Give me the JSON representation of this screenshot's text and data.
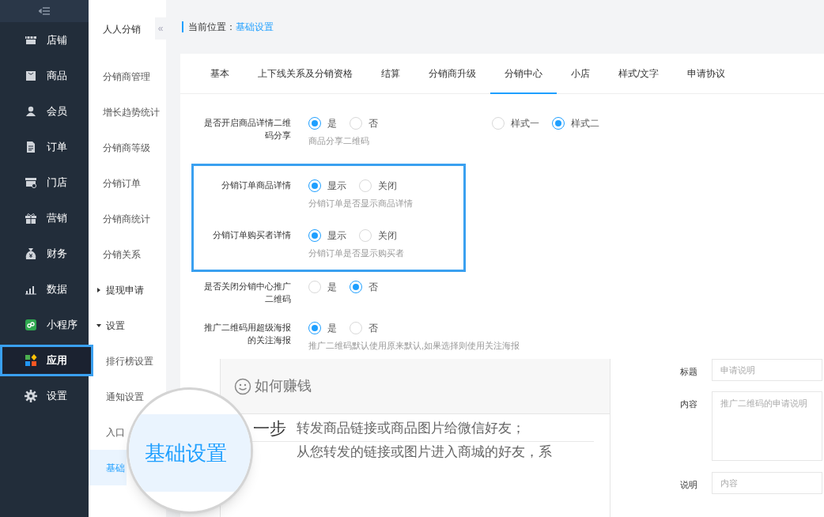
{
  "sidebar": {
    "items": [
      {
        "label": "店铺",
        "selected": false
      },
      {
        "label": "商品",
        "selected": false
      },
      {
        "label": "会员",
        "selected": false
      },
      {
        "label": "订单",
        "selected": false
      },
      {
        "label": "门店",
        "selected": false
      },
      {
        "label": "营销",
        "selected": false
      },
      {
        "label": "财务",
        "selected": false
      },
      {
        "label": "数据",
        "selected": false
      },
      {
        "label": "小程序",
        "selected": false
      },
      {
        "label": "应用",
        "selected": true
      },
      {
        "label": "设置",
        "selected": false
      }
    ]
  },
  "subnav": {
    "title": "人人分销",
    "collapse": "«",
    "items": [
      {
        "kind": "link",
        "label": "分销商管理",
        "selected": false
      },
      {
        "kind": "link",
        "label": "增长趋势统计",
        "selected": false
      },
      {
        "kind": "link",
        "label": "分销商等级",
        "selected": false
      },
      {
        "kind": "link",
        "label": "分销订单",
        "selected": false
      },
      {
        "kind": "link",
        "label": "分销商统计",
        "selected": false
      },
      {
        "kind": "link",
        "label": "分销关系",
        "selected": false
      },
      {
        "kind": "group",
        "label": "提现申请",
        "expanded": false
      },
      {
        "kind": "group",
        "label": "设置",
        "expanded": true
      },
      {
        "kind": "sub",
        "label": "排行榜设置",
        "selected": false
      },
      {
        "kind": "sub",
        "label": "通知设置",
        "selected": false
      },
      {
        "kind": "sub",
        "label": "入口",
        "selected": false
      },
      {
        "kind": "sub",
        "label": "基础",
        "selected": true
      }
    ]
  },
  "breadcrumb": {
    "label": "当前位置：",
    "current": "基础设置"
  },
  "tabs": [
    {
      "label": "基本",
      "selected": false
    },
    {
      "label": "上下线关系及分销资格",
      "selected": false
    },
    {
      "label": "结算",
      "selected": false
    },
    {
      "label": "分销商升级",
      "selected": false
    },
    {
      "label": "分销中心",
      "selected": true
    },
    {
      "label": "小店",
      "selected": false
    },
    {
      "label": "样式/文字",
      "selected": false
    },
    {
      "label": "申请协议",
      "selected": false
    }
  ],
  "settings": [
    {
      "label": "是否开启商品详情二维码分享",
      "highlighted": false,
      "options": [
        {
          "label": "是",
          "selected": true
        },
        {
          "label": "否",
          "selected": false
        }
      ],
      "hint": "商品分享二维码",
      "extra_options": [
        {
          "label": "样式一",
          "selected": false
        },
        {
          "label": "样式二",
          "selected": true
        }
      ]
    },
    {
      "label": "分销订单商品详情",
      "highlighted": true,
      "options": [
        {
          "label": "显示",
          "selected": true
        },
        {
          "label": "关闭",
          "selected": false
        }
      ],
      "hint": "分销订单是否显示商品详情"
    },
    {
      "label": "分销订单购买者详情",
      "highlighted": true,
      "options": [
        {
          "label": "显示",
          "selected": true
        },
        {
          "label": "关闭",
          "selected": false
        }
      ],
      "hint": "分销订单是否显示购买者"
    },
    {
      "label": "是否关闭分销中心推广二维码",
      "highlighted": false,
      "options": [
        {
          "label": "是",
          "selected": false
        },
        {
          "label": "否",
          "selected": true
        }
      ]
    },
    {
      "label": "推广二维码用超级海报的关注海报",
      "highlighted": false,
      "options": [
        {
          "label": "是",
          "selected": true
        },
        {
          "label": "否",
          "selected": false
        }
      ],
      "hint": "推广二维码默认使用原来默认,如果选择则使用关注海报"
    }
  ],
  "preview": {
    "title": "如何赚钱",
    "steps": [
      {
        "step": "一步",
        "text": "转发商品链接或商品图片给微信好友；"
      },
      {
        "text": "从您转发的链接或图片进入商城的好友，系"
      }
    ]
  },
  "form": [
    {
      "kind": "input",
      "label": "标题",
      "placeholder": "申请说明"
    },
    {
      "kind": "textarea",
      "label": "内容",
      "placeholder": "推广二维码的申请说明"
    },
    {
      "kind": "input",
      "label": "说明",
      "placeholder": "内容"
    }
  ],
  "magnifier": {
    "text": "基础设置"
  }
}
